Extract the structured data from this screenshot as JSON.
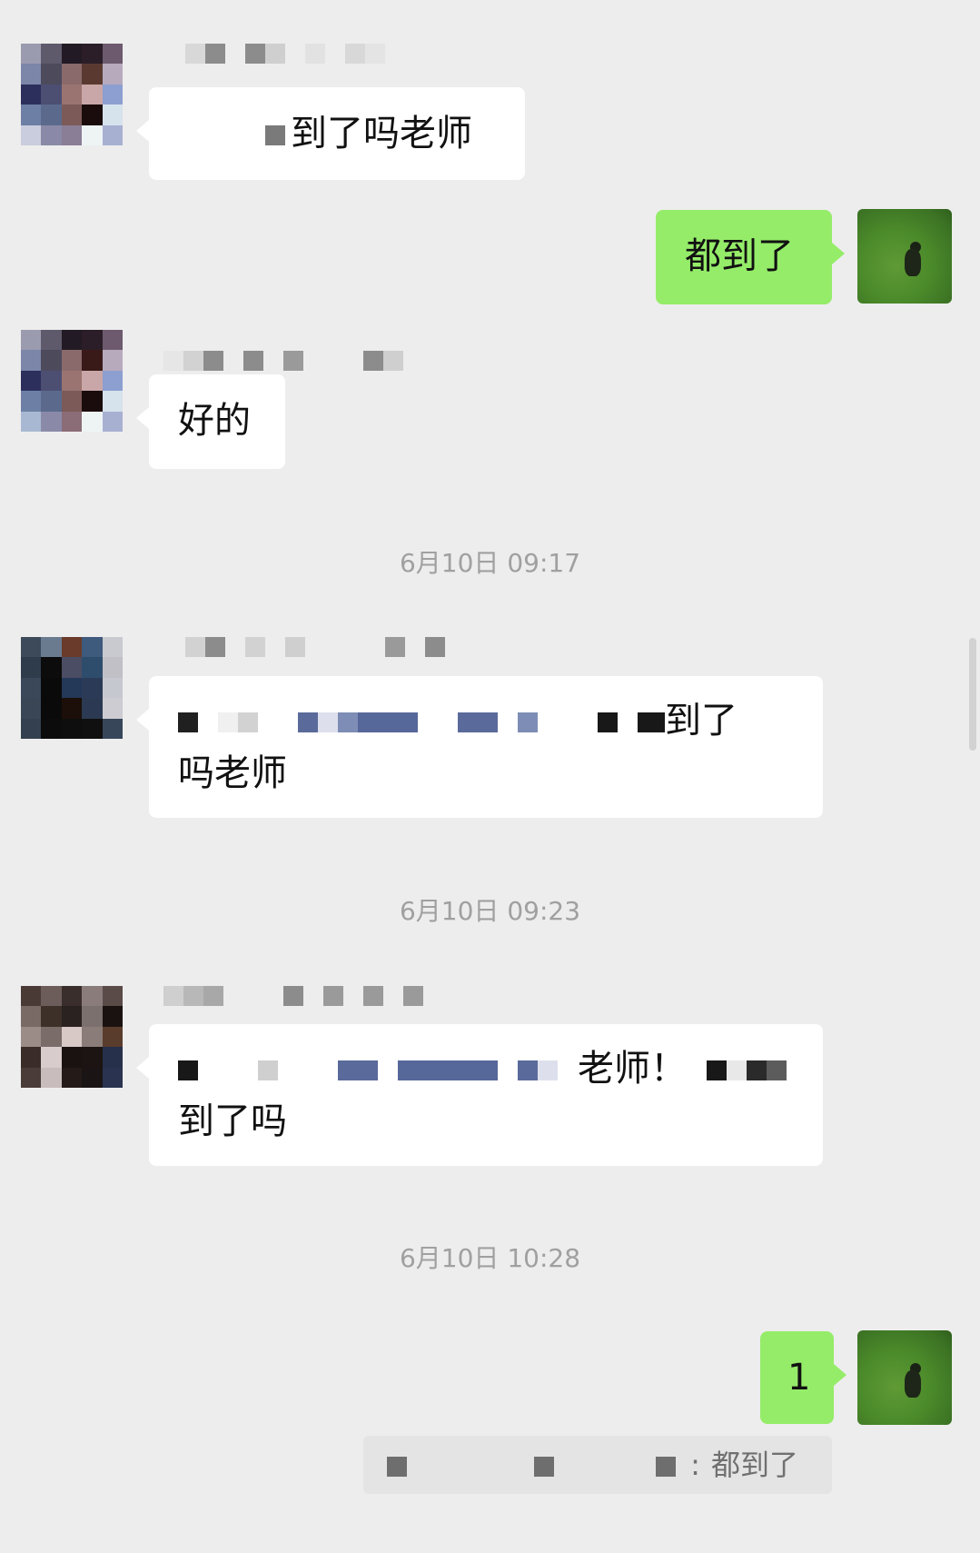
{
  "messages": [
    {
      "side": "left",
      "text": "到了吗老师"
    },
    {
      "side": "right",
      "text": "都到了"
    },
    {
      "side": "left",
      "text": "好的"
    },
    {
      "side": "left",
      "text_line1": "到了",
      "text_line2": "吗老师"
    },
    {
      "side": "left",
      "text_line1": "老师！",
      "text_line2": "到了吗"
    },
    {
      "side": "right",
      "text": "1"
    }
  ],
  "timestamps": [
    "6月10日 09:17",
    "6月10日 09:23",
    "6月10日 10:28"
  ],
  "quote": {
    "separator": ":",
    "text": "都到了"
  },
  "colors": {
    "background": "#ededed",
    "own_bubble": "#95ec69",
    "other_bubble": "#ffffff",
    "timestamp": "#a0a0a0"
  }
}
